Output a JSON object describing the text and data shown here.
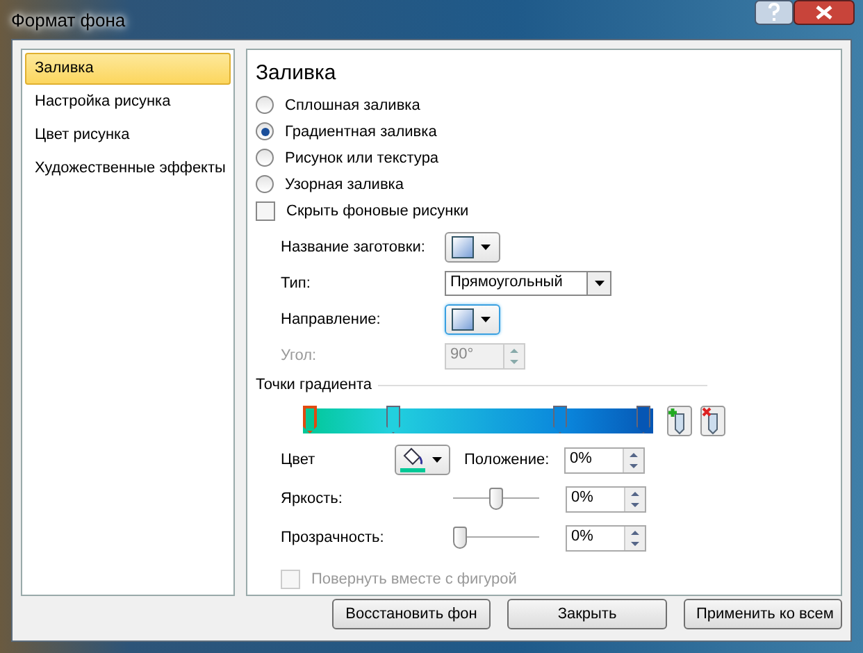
{
  "window": {
    "title": "Формат фона"
  },
  "sidebar": {
    "items": [
      {
        "label": "Заливка",
        "selected": true
      },
      {
        "label": "Настройка рисунка",
        "selected": false
      },
      {
        "label": "Цвет рисунка",
        "selected": false
      },
      {
        "label": "Художественные эффекты",
        "selected": false
      }
    ]
  },
  "panel": {
    "heading": "Заливка",
    "fill_options": [
      {
        "label": "Сплошная заливка",
        "selected": false
      },
      {
        "label": "Градиентная заливка",
        "selected": true
      },
      {
        "label": "Рисунок или текстура",
        "selected": false
      },
      {
        "label": "Узорная заливка",
        "selected": false
      }
    ],
    "hide_background": {
      "label": "Скрыть фоновые рисунки",
      "checked": false
    },
    "preset": {
      "label": "Название заготовки:"
    },
    "type": {
      "label": "Тип:",
      "value": "Прямоугольный"
    },
    "direction": {
      "label": "Направление:"
    },
    "angle": {
      "label": "Угол:",
      "value": "90°",
      "disabled": true
    },
    "gradient_stops": {
      "label": "Точки градиента",
      "stops": [
        {
          "level": 0,
          "color": "#00c896",
          "selected": true
        },
        {
          "level": 0.25,
          "color": "#22d0de",
          "selected": false
        },
        {
          "level": 0.75,
          "color": "#0a86dc",
          "selected": false
        },
        {
          "level": 1,
          "color": "#0656b4",
          "selected": false
        }
      ]
    },
    "color": {
      "label": "Цвет"
    },
    "position": {
      "label": "Положение:",
      "value": "0%"
    },
    "brightness": {
      "label": "Яркость:",
      "level": 0.5,
      "value": "0%"
    },
    "transparency": {
      "label": "Прозрачность:",
      "level": 0,
      "value": "0%"
    },
    "rotate": {
      "label": "Повернуть вместе с фигурой",
      "checked": false,
      "disabled": true
    }
  },
  "buttons": [
    "Восстановить фон",
    "Закрыть",
    "Применить ко всем"
  ]
}
